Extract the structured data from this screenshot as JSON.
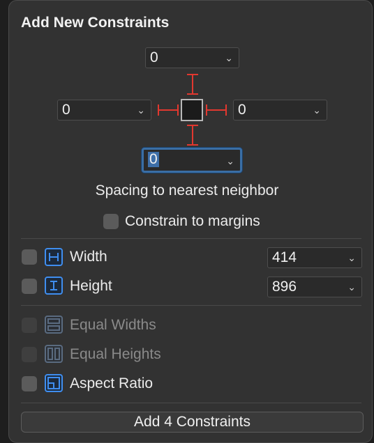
{
  "title": "Add New Constraints",
  "spacing": {
    "top": "0",
    "left": "0",
    "right": "0",
    "bottom": "0",
    "caption": "Spacing to nearest neighbor"
  },
  "constrain_margins": {
    "label": "Constrain to margins",
    "checked": false
  },
  "size": {
    "width": {
      "label": "Width",
      "value": "414",
      "checked": false
    },
    "height": {
      "label": "Height",
      "value": "896",
      "checked": false
    }
  },
  "equal": {
    "widths": {
      "label": "Equal Widths",
      "enabled": false
    },
    "heights": {
      "label": "Equal Heights",
      "enabled": false
    },
    "aspect": {
      "label": "Aspect Ratio",
      "enabled": true
    }
  },
  "button": {
    "label": "Add 4 Constraints"
  },
  "colors": {
    "strut": "#e2382f",
    "icon": "#3f8ef0",
    "focus": "#3a6ea5"
  },
  "icons": [
    "chevron-down-icon",
    "width-constraint-icon",
    "height-constraint-icon",
    "equal-widths-icon",
    "equal-heights-icon",
    "aspect-ratio-icon"
  ]
}
